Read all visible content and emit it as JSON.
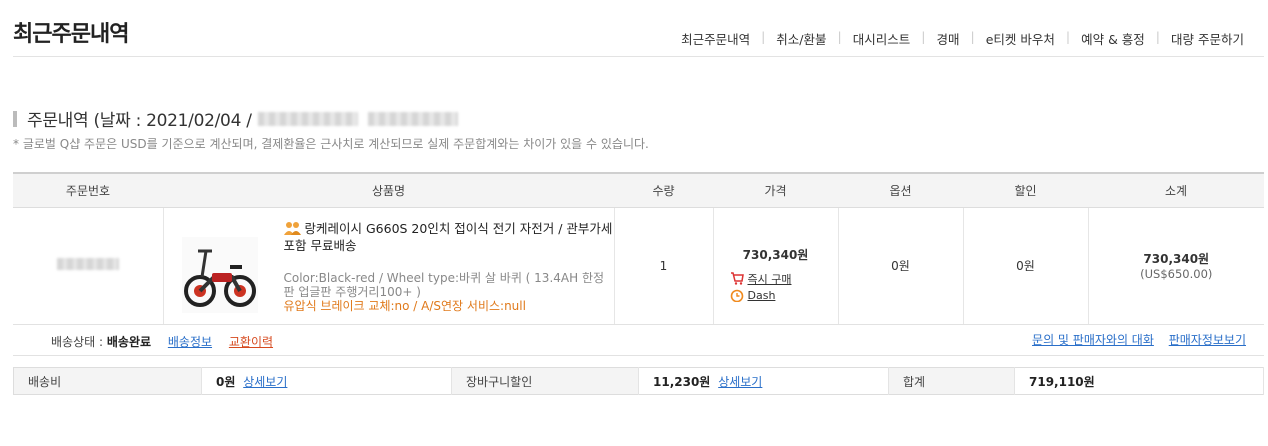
{
  "page": {
    "title": "최근주문내역"
  },
  "nav": [
    {
      "label": "최근주문내역"
    },
    {
      "label": "취소/환불"
    },
    {
      "label": "대시리스트"
    },
    {
      "label": "경매"
    },
    {
      "label": "e티켓 바우처"
    },
    {
      "label": "예약 & 흥정"
    },
    {
      "label": "대량 주문하기"
    }
  ],
  "section": {
    "title_prefix": "주문내역 (날짜 : 2021/02/04 /",
    "notice": "* 글로벌 Q샵 주문은 USD를 기준으로 계산되며, 결제환율은 근사치로 계산되므로 실제 주문합계와는 차이가 있을 수 있습니다."
  },
  "table": {
    "headers": [
      "주문번호",
      "상품명",
      "수량",
      "가격",
      "옵션",
      "할인",
      "소계"
    ],
    "row": {
      "product_title": "랑케레이시 G660S 20인치 접이식 전기 자전거 / 관부가세 포함 무료배송",
      "option_line": "Color:Black-red / Wheel type:바퀴 살 바퀴 ( 13.4AH 한정판 업글판 주행거리100+ )",
      "option_orange": "유압식 브레이크 교체:no / A/S연장 서비스:null",
      "quantity": "1",
      "price": "730,340원",
      "instant_buy": "즉시 구매",
      "dash": "Dash",
      "option_price": "0원",
      "discount": "0원",
      "subtotal": "730,340원",
      "subtotal_usd": "(US$650.00)"
    }
  },
  "status": {
    "label": "배송상태 :",
    "value": "배송완료",
    "shipping_info": "배송정보",
    "exchange_history": "교환이력",
    "contact_seller": "문의 및 판매자와의 대화",
    "seller_info": "판매자정보보기"
  },
  "summary": {
    "shipping_label": "배송비",
    "shipping_value": "0원",
    "shipping_detail": "상세보기",
    "cart_discount_label": "장바구니할인",
    "cart_discount_value": "11,230원",
    "cart_discount_detail": "상세보기",
    "total_label": "합계",
    "total_value": "719,110원"
  },
  "colors": {
    "orange_option": "#e07a1c",
    "link_blue": "#2a6fc9",
    "link_red": "#d64a1f",
    "seller_icon": "#f0a23a"
  },
  "icons": {
    "seller": "seller-badge-icon",
    "instant_buy": "cart-icon",
    "dash": "clock-icon"
  }
}
